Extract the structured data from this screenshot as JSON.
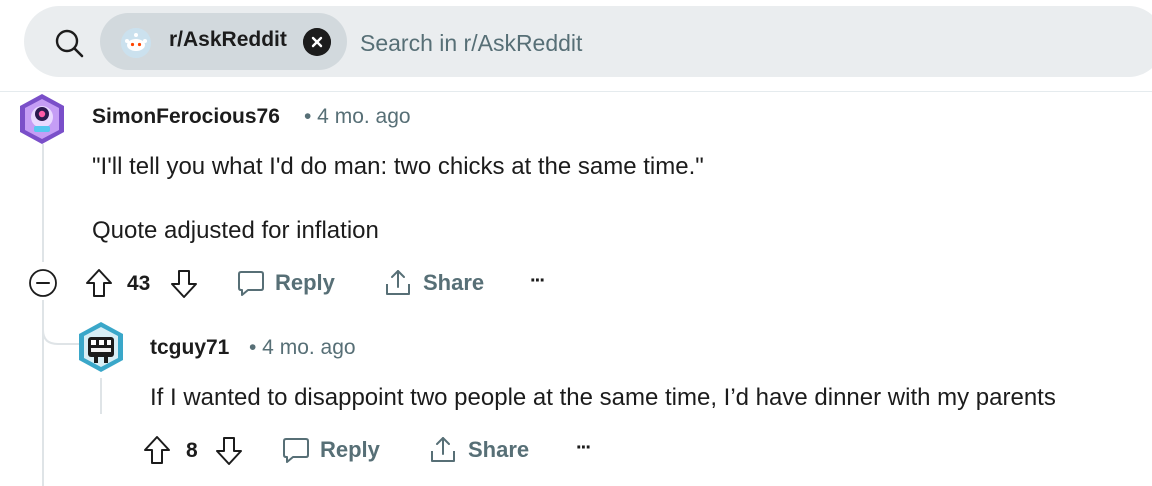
{
  "search": {
    "community_chip_label": "r/AskReddit",
    "placeholder": "Search in r/AskReddit"
  },
  "comments": [
    {
      "author": "SimonFerocious76",
      "meta": "• 4 mo. ago",
      "body": [
        "\"I'll tell you what I'd do man: two chicks at the same time.\"",
        "Quote adjusted for inflation"
      ],
      "votes": "43",
      "reply_label": "Reply",
      "share_label": "Share",
      "more_label": "···"
    },
    {
      "author": "tcguy71",
      "meta": "• 4 mo. ago",
      "body": [
        "If I wanted to disappoint two people at the same time, I’d have dinner with my parents"
      ],
      "votes": "8",
      "reply_label": "Reply",
      "share_label": "Share",
      "more_label": "···"
    }
  ],
  "colors": {
    "search_bg": "#eaedef",
    "chip_bg": "#d2d9dd",
    "meta_text": "#576f76",
    "primary_text": "#1c1c1c"
  }
}
